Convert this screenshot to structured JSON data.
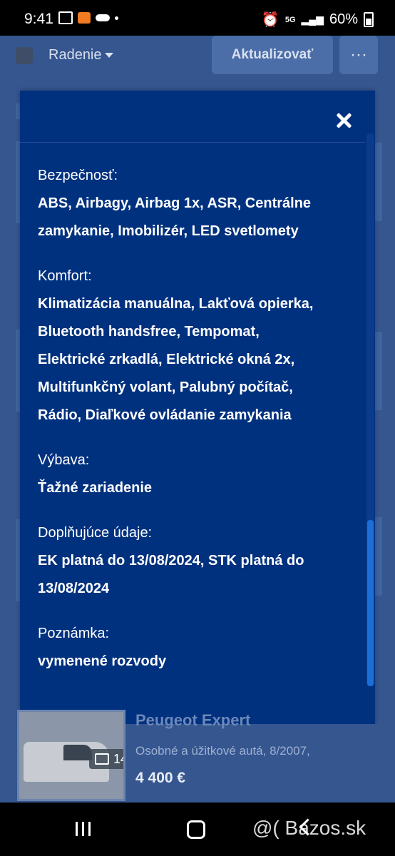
{
  "status_bar": {
    "time": "9:41",
    "battery": "60%",
    "network": "5G"
  },
  "toolbar": {
    "sort_label": "Radenie",
    "update_label": "Aktualizovať",
    "more_label": "···"
  },
  "modal": {
    "sections": [
      {
        "label": "Bezpečnosť:",
        "lines": [
          "ABS, Airbagy, Airbag 1x, ASR, Centrálne",
          "zamykanie, Imobilizér, LED svetlomety"
        ]
      },
      {
        "label": "Komfort:",
        "lines": [
          "Klimatizácia manuálna, Lakťová opierka,",
          "Bluetooth handsfree, Tempomat,",
          "Elektrické zrkadlá, Elektrické okná 2x,",
          "Multifunkčný volant, Palubný počítač,",
          "Rádio, Diaľkové ovládanie zamykania"
        ]
      },
      {
        "label": "Výbava:",
        "lines": [
          "Ťažné zariadenie"
        ]
      },
      {
        "label": "Doplňujúce údaje:",
        "lines": [
          "EK platná do 13/08/2024, STK platná do",
          "13/08/2024"
        ]
      },
      {
        "label": "Poznámka:",
        "lines": [
          "vymenené rozvody"
        ]
      }
    ]
  },
  "listing": {
    "title": "Peugeot Expert",
    "description": "Osobné a úžitkové autá, 8/2007,",
    "price": "4 400 €",
    "photo_count": "14"
  },
  "watermark": "@( Bazos.sk"
}
